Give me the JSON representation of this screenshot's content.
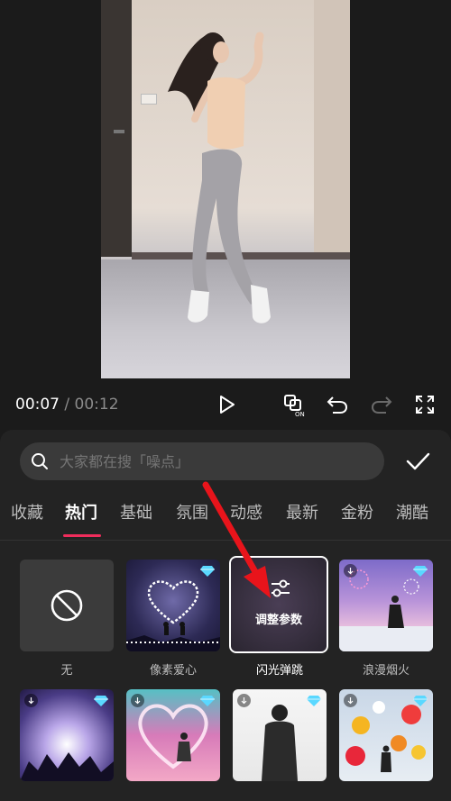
{
  "player": {
    "current_time": "00:07",
    "separator": "/",
    "total_time": "00:12"
  },
  "search": {
    "placeholder": "大家都在搜「噪点」"
  },
  "tabs": [
    {
      "label": "收藏",
      "active": false
    },
    {
      "label": "热门",
      "active": true
    },
    {
      "label": "基础",
      "active": false
    },
    {
      "label": "氛围",
      "active": false
    },
    {
      "label": "动感",
      "active": false
    },
    {
      "label": "最新",
      "active": false
    },
    {
      "label": "金粉",
      "active": false
    },
    {
      "label": "潮酷",
      "active": false
    }
  ],
  "effects_row1": [
    {
      "label": "无",
      "selected": false
    },
    {
      "label": "像素爱心",
      "selected": false,
      "premium": true
    },
    {
      "label": "闪光弹跳",
      "selected": true,
      "overlay_text": "调整参数"
    },
    {
      "label": "浪漫烟火",
      "selected": false,
      "premium": true,
      "downloadable": true
    }
  ],
  "effects_row2": [
    {
      "label": "",
      "premium": true,
      "downloadable": true
    },
    {
      "label": "",
      "premium": true,
      "downloadable": true
    },
    {
      "label": "",
      "premium": true,
      "downloadable": true
    },
    {
      "label": "",
      "premium": true,
      "downloadable": true
    }
  ],
  "colors": {
    "accent_underline": "#f02d5c",
    "background": "#1b1b1b",
    "panel": "#232323",
    "annotation_arrow": "#e8141b",
    "premium_gem": "#5ad8ff"
  },
  "icons": [
    "play-icon",
    "caption-on-icon",
    "undo-icon",
    "redo-icon",
    "fullscreen-icon",
    "search-icon",
    "check-icon",
    "no-effect-icon",
    "adjust-params-icon",
    "download-icon",
    "premium-gem-icon"
  ]
}
